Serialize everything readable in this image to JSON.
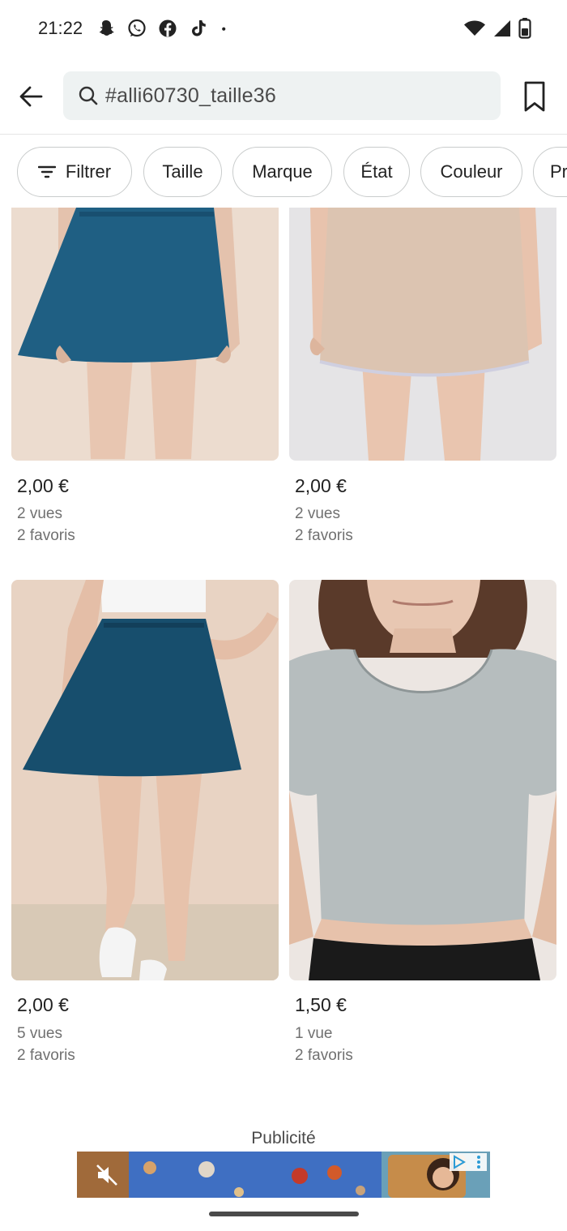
{
  "status_bar": {
    "time": "21:22",
    "left_icons": [
      "snapchat-icon",
      "whatsapp-icon",
      "facebook-icon",
      "tiktok-icon",
      "more-dot-icon"
    ],
    "right_icons": [
      "wifi-icon",
      "signal-icon",
      "battery-icon"
    ]
  },
  "header": {
    "search_query": "#alli60730_taille36",
    "back_icon": "arrow-left-icon",
    "search_icon": "search-icon",
    "bookmark_icon": "bookmark-icon"
  },
  "filters": {
    "chips": [
      {
        "label": "Filtrer",
        "icon": "filter-icon"
      },
      {
        "label": "Taille"
      },
      {
        "label": "Marque"
      },
      {
        "label": "État"
      },
      {
        "label": "Couleur"
      },
      {
        "label": "Pr"
      }
    ]
  },
  "products": [
    {
      "price": "2,00 €",
      "views": "2 vues",
      "favorites": "2 favoris",
      "image": "blue skirt"
    },
    {
      "price": "2,00 €",
      "views": "2 vues",
      "favorites": "2 favoris",
      "image": "beige skirt"
    },
    {
      "price": "2,00 €",
      "views": "5 vues",
      "favorites": "2 favoris",
      "image": "denim skirt"
    },
    {
      "price": "1,50 €",
      "views": "1 vue",
      "favorites": "2 favoris",
      "image": "grey crop top"
    }
  ],
  "ad": {
    "label": "Publicité",
    "icons": [
      "muted-speaker-icon",
      "ad-choices-icon"
    ]
  },
  "colors": {
    "search_bg": "#eef2f2",
    "chip_border": "#c9cccc",
    "meta_text": "#707070",
    "ad_blue": "#3f6fc2"
  }
}
